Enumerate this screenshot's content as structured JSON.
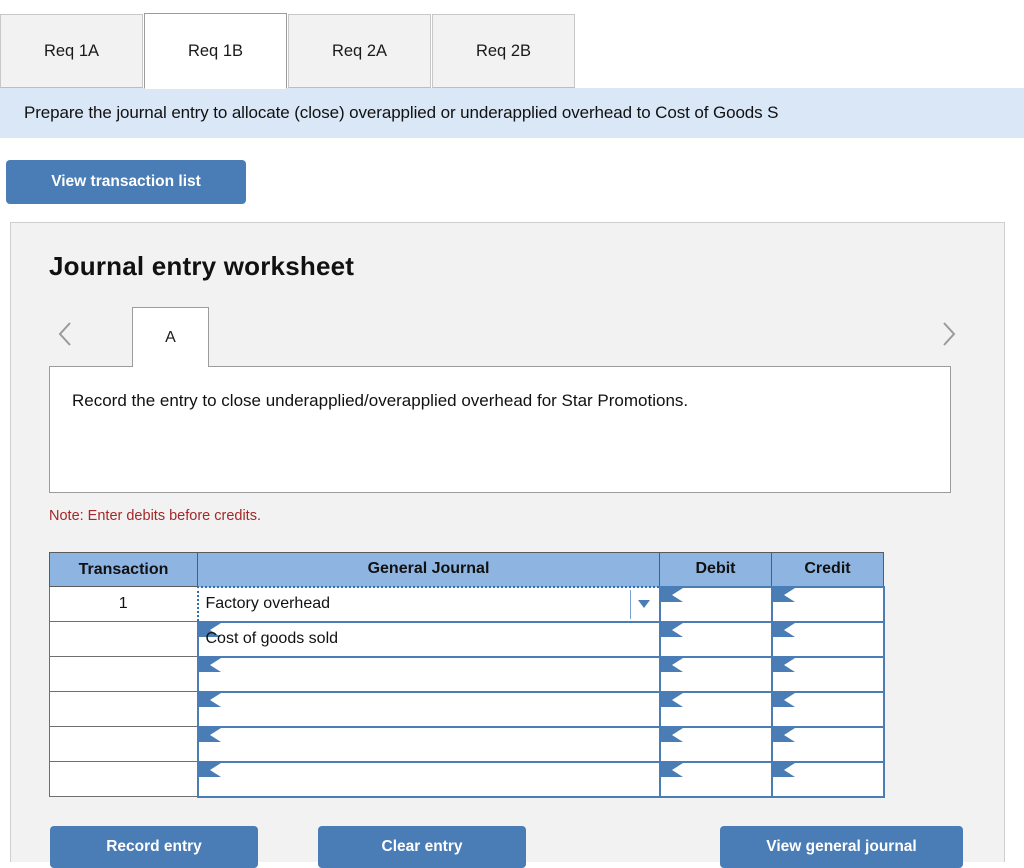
{
  "req_tabs": [
    {
      "label": "Req 1A",
      "active": false
    },
    {
      "label": "Req 1B",
      "active": true
    },
    {
      "label": "Req 2A",
      "active": false
    },
    {
      "label": "Req 2B",
      "active": false
    }
  ],
  "instruction": {
    "text": "Prepare the journal entry to allocate (close) overapplied or underapplied overhead to Cost of Goods S"
  },
  "toolbar": {
    "view_transaction_list_label": "View transaction list"
  },
  "worksheet": {
    "title": "Journal entry worksheet",
    "prev_icon": "‹",
    "next_icon": "›",
    "entry_tabs": [
      {
        "label": "A",
        "active": true
      }
    ],
    "description": "Record the entry to close underapplied/overapplied overhead for Star Promotions.",
    "note": "Note: Enter debits before credits."
  },
  "table": {
    "headers": [
      "Transaction",
      "General Journal",
      "Debit",
      "Credit"
    ],
    "rows": [
      {
        "transaction": "1",
        "account": "Factory overhead",
        "debit": "",
        "credit": "",
        "selected": true
      },
      {
        "transaction": "",
        "account": "Cost of goods sold",
        "debit": "",
        "credit": "",
        "selected": false
      },
      {
        "transaction": "",
        "account": "",
        "debit": "",
        "credit": "",
        "selected": false
      },
      {
        "transaction": "",
        "account": "",
        "debit": "",
        "credit": "",
        "selected": false
      },
      {
        "transaction": "",
        "account": "",
        "debit": "",
        "credit": "",
        "selected": false
      },
      {
        "transaction": "",
        "account": "",
        "debit": "",
        "credit": "",
        "selected": false
      }
    ]
  },
  "actions": {
    "record_entry_label": "Record entry",
    "clear_entry_label": "Clear entry",
    "view_general_journal_label": "View general journal"
  },
  "colors": {
    "accent_blue": "#4a7cb5",
    "banner_blue": "#d9e7f7",
    "header_blue": "#8eb4e2",
    "note_red": "#a3282a",
    "panel_gray": "#f2f2f2"
  }
}
